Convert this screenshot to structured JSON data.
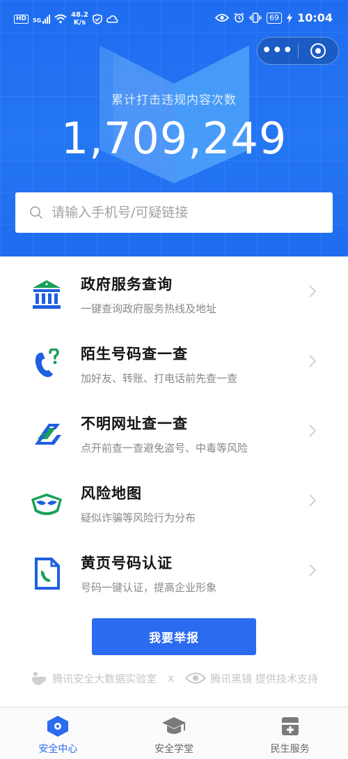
{
  "status_bar": {
    "network_badge": "HD",
    "signal_label": "5G",
    "speed_value": "48.2",
    "speed_unit": "K/s",
    "battery": "69",
    "time": "10:04"
  },
  "hero": {
    "stat_label": "累计打击违规内容次数",
    "stat_value": "1,709,249"
  },
  "search": {
    "placeholder": "请输入手机号/可疑链接"
  },
  "services": [
    {
      "title": "政府服务查询",
      "desc": "一键查询政府服务热线及地址",
      "icon": "government-building-icon"
    },
    {
      "title": "陌生号码查一查",
      "desc": "加好友、转账、打电话前先查一查",
      "icon": "phone-question-icon"
    },
    {
      "title": "不明网址查一查",
      "desc": "点开前查一查避免盗号、中毒等风险",
      "icon": "link-icon"
    },
    {
      "title": "风险地图",
      "desc": "疑似诈骗等风险行为分布",
      "icon": "mask-icon"
    },
    {
      "title": "黄页号码认证",
      "desc": "号码一键认证，提高企业形象",
      "icon": "yellow-pages-phone-icon"
    }
  ],
  "report_button": "我要举报",
  "credits": {
    "lab": "腾讯安全大数据实验室",
    "separator": "x",
    "partner": "腾讯黑镜 提供技术支持"
  },
  "tabs": [
    {
      "label": "安全中心",
      "active": true,
      "icon": "shield-eye-icon"
    },
    {
      "label": "安全学堂",
      "active": false,
      "icon": "graduation-cap-icon"
    },
    {
      "label": "民生服务",
      "active": false,
      "icon": "medical-kit-icon"
    }
  ],
  "colors": {
    "brand_blue": "#2a6bef",
    "green": "#18a058",
    "icon_blue": "#1f5fe0"
  }
}
